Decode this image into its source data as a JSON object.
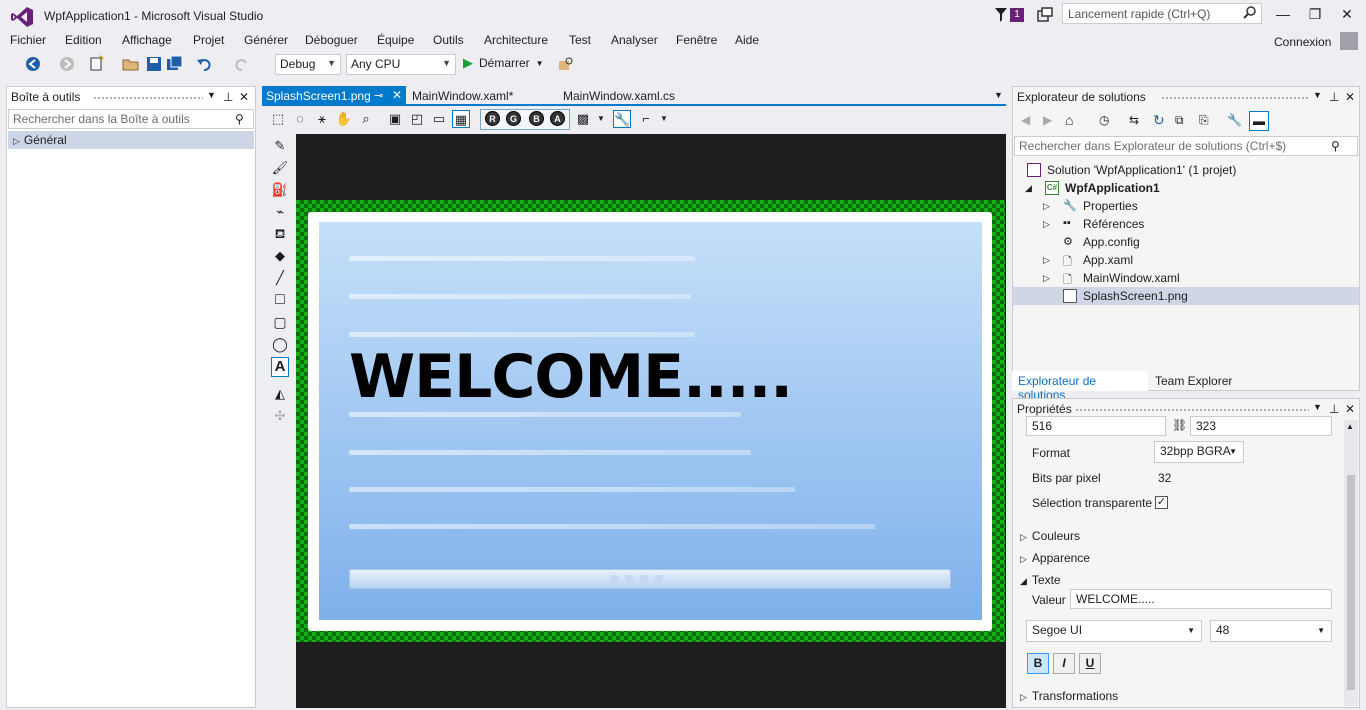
{
  "window": {
    "title": "WpfApplication1 - Microsoft Visual Studio",
    "notification_count": "1",
    "quick_launch_placeholder": "Lancement rapide (Ctrl+Q)",
    "account": "Connexion",
    "minimize": "—",
    "maximize": "❐",
    "close": "✕"
  },
  "menu": [
    "Fichier",
    "Edition",
    "Affichage",
    "Projet",
    "Générer",
    "Déboguer",
    "Équipe",
    "Outils",
    "Architecture",
    "Test",
    "Analyser",
    "Fenêtre",
    "Aide"
  ],
  "toolbar": {
    "configuration": "Debug",
    "platform": "Any CPU",
    "start_label": "Démarrer"
  },
  "toolbox": {
    "title": "Boîte à outils",
    "search_placeholder": "Rechercher dans la Boîte à outils",
    "group": "Général"
  },
  "editor": {
    "tabs": [
      {
        "label": "SplashScreen1.png",
        "active": true
      },
      {
        "label": "MainWindow.xaml*",
        "active": false
      },
      {
        "label": "MainWindow.xaml.cs",
        "active": false
      }
    ],
    "channels": [
      "R",
      "G",
      "B",
      "A"
    ],
    "image_text": "WELCOME....."
  },
  "solution_explorer": {
    "title": "Explorateur de solutions",
    "search_placeholder": "Rechercher dans Explorateur de solutions (Ctrl+$)",
    "items": [
      {
        "label": "Solution 'WpfApplication1' (1 projet)",
        "icon": "solution-icon"
      },
      {
        "label": "WpfApplication1",
        "icon": "csharp-project-icon"
      },
      {
        "label": "Properties",
        "icon": "wrench-icon"
      },
      {
        "label": "Références",
        "icon": "references-icon"
      },
      {
        "label": "App.config",
        "icon": "config-file-icon"
      },
      {
        "label": "App.xaml",
        "icon": "xaml-file-icon"
      },
      {
        "label": "MainWindow.xaml",
        "icon": "xaml-file-icon"
      },
      {
        "label": "SplashScreen1.png",
        "icon": "image-file-icon"
      }
    ],
    "tabs": [
      "Explorateur de solutions",
      "Team Explorer"
    ]
  },
  "properties": {
    "title": "Propriétés",
    "width": "516",
    "height": "323",
    "format_label": "Format",
    "format_value": "32bpp BGRA",
    "bpp_label": "Bits par pixel",
    "bpp_value": "32",
    "transparent_label": "Sélection transparente",
    "transparent_checked": true,
    "sections": {
      "colors": "Couleurs",
      "appearance": "Apparence",
      "text": "Texte",
      "transformations": "Transformations"
    },
    "value_label": "Valeur",
    "value": "WELCOME.....",
    "font": "Segoe UI",
    "font_size": "48",
    "bold": "B",
    "italic": "I",
    "underline": "U"
  },
  "colors": {
    "accent": "#007acc",
    "vs_purple": "#68217a",
    "canvas": "#1e1e1e",
    "checker_green": "#15b015"
  }
}
